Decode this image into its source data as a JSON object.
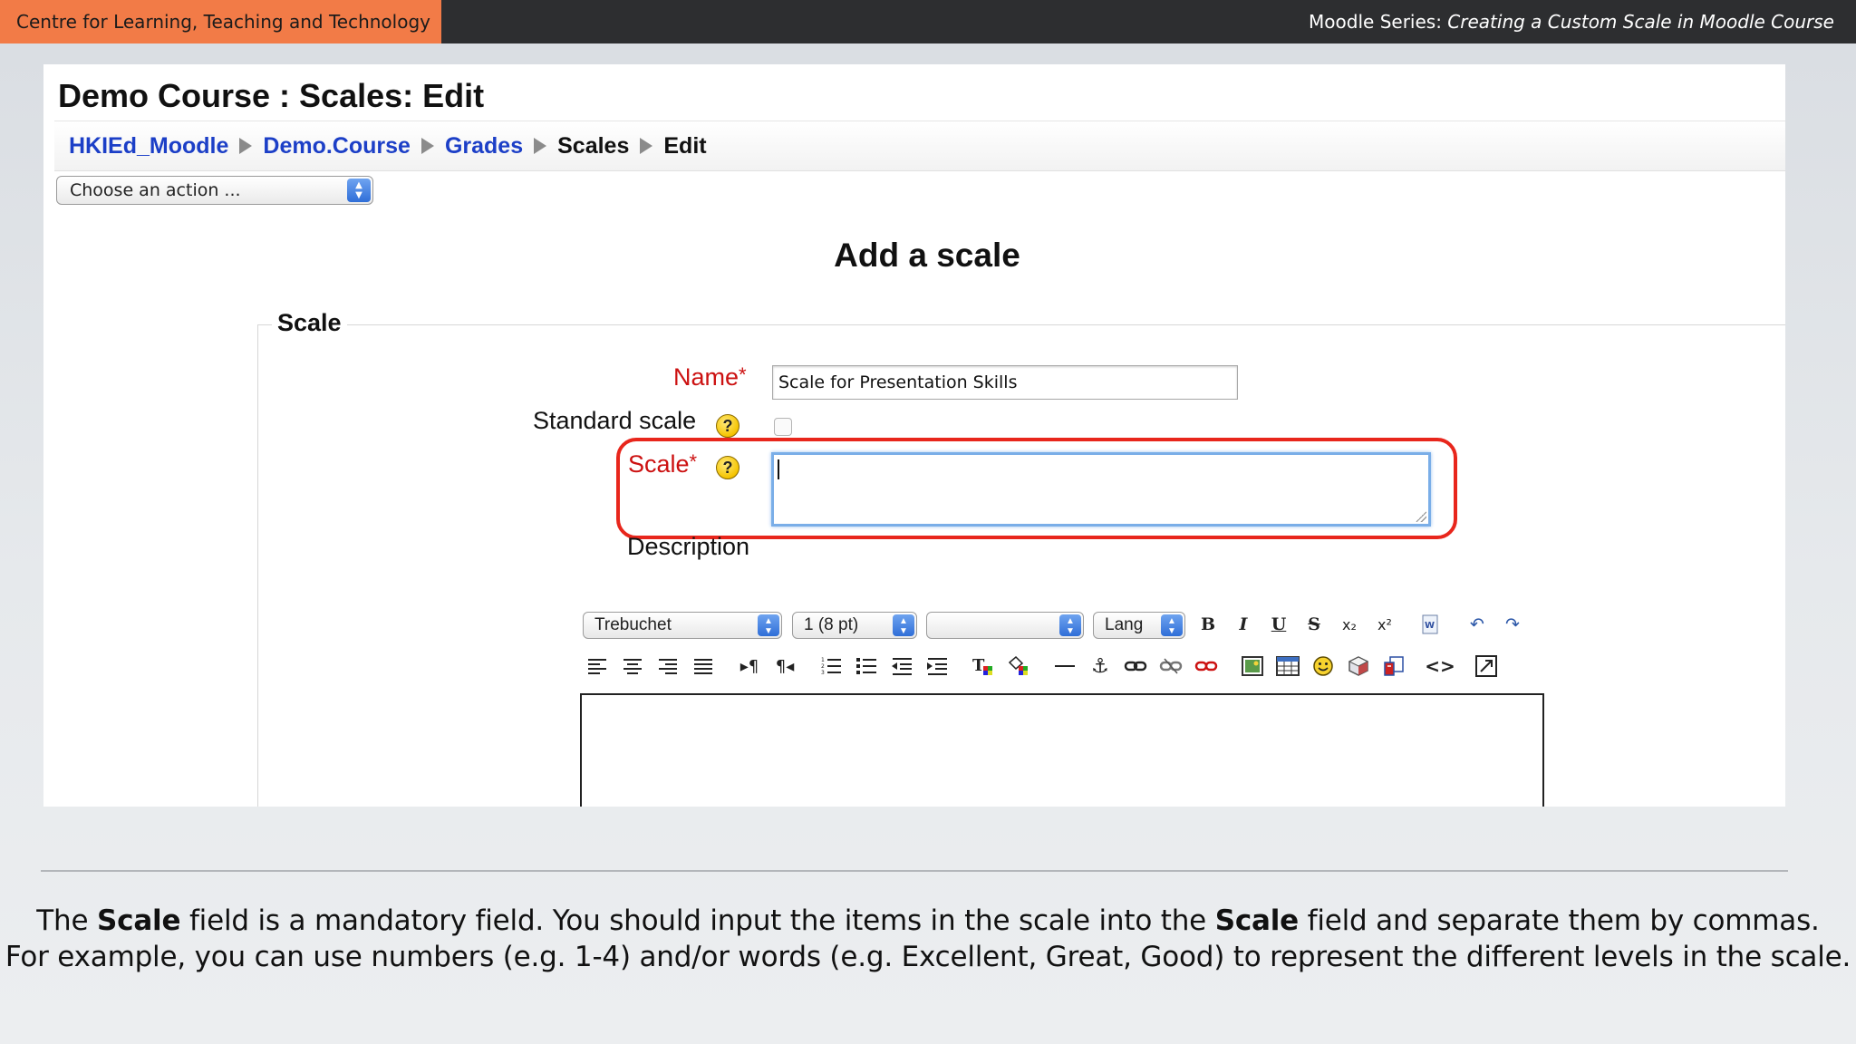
{
  "slide": {
    "org_label": "Centre for Learning, Teaching and Technology",
    "series_prefix": "Moodle Series: ",
    "series_title": "Creating a Custom Scale in Moodle Course"
  },
  "moodle": {
    "page_title": "Demo Course : Scales: Edit",
    "breadcrumb": [
      {
        "label": "HKIEd_Moodle",
        "link": true
      },
      {
        "label": "Demo.Course",
        "link": true
      },
      {
        "label": "Grades",
        "link": true
      },
      {
        "label": "Scales",
        "link": false
      },
      {
        "label": "Edit",
        "link": false
      }
    ],
    "action_select": "Choose an action ...",
    "form_heading": "Add a scale",
    "fieldset_legend": "Scale",
    "name_label": "Name",
    "name_value": "Scale for Presentation Skills",
    "standard_scale_label": "Standard scale",
    "standard_scale_checked": false,
    "scale_label": "Scale",
    "scale_value": "",
    "description_label": "Description",
    "required_marker": "*",
    "help_glyph": "?",
    "editor": {
      "font_family": "Trebuchet",
      "font_size": "1 (8 pt)",
      "format": "",
      "lang": "Lang",
      "row1_icons": [
        "bold-icon",
        "italic-icon",
        "underline-icon",
        "strikethrough-icon",
        "subscript-icon",
        "superscript-icon",
        "paste-word-icon",
        "undo-icon",
        "redo-icon"
      ],
      "row2_icons": [
        "align-left-icon",
        "align-center-icon",
        "align-right-icon",
        "justify-icon",
        "ltr-icon",
        "rtl-icon",
        "ordered-list-icon",
        "unordered-list-icon",
        "outdent-icon",
        "indent-icon",
        "text-color-icon",
        "background-color-icon",
        "horizontal-rule-icon",
        "anchor-icon",
        "link-icon",
        "unlink-icon",
        "nolink-icon",
        "image-icon",
        "table-icon",
        "emoticon-icon",
        "search-replace-icon",
        "clean-html-icon",
        "html-source-icon",
        "fullscreen-icon"
      ]
    }
  },
  "caption": {
    "line1_a": "The ",
    "line1_b": "Scale",
    "line1_c": " field is a mandatory field. You should input the items in the scale into the ",
    "line1_d": "Scale",
    "line1_e": " field and separate them by commas.",
    "line2": "For example, you can use numbers  (e.g. 1-4) and/or words (e.g. Excellent, Great, Good) to represent the different levels in the scale."
  },
  "colors": {
    "org_bar": "#f27b47",
    "top_bar": "#2d2e30",
    "link_blue": "#1c3fc7",
    "required_red": "#cc1111",
    "highlight_red": "#e8261c"
  }
}
